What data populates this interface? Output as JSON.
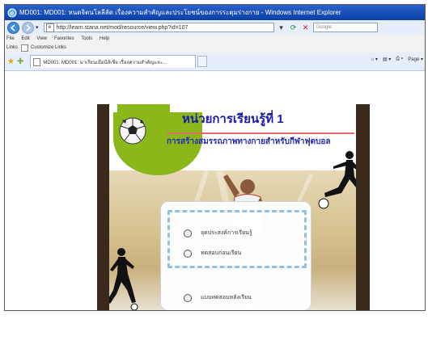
{
  "browser": {
    "window_title": "MD001: MD001: หนดจิตนโลลีลัด เรื่องความสำคัญและประโยชน์ของการระดุมร่างกาย - Windows Internet Explorer",
    "address_url": "http://learn.stana.net/mod/resource/view.php?id=107",
    "search_placeholder": "Google",
    "menu": [
      "File",
      "Edit",
      "View",
      "Favorites",
      "Tools",
      "Help"
    ],
    "links_label": "Links",
    "links_item": "Customize Links",
    "tab_title": "MD001: MD001: มาเรียนเมือนีส์เชีย เรื่องความสำคัญและ...",
    "page_label": "Page ▾"
  },
  "lesson": {
    "heading": "หน่วยการเรียนรู้ที่ 1",
    "subheading": "การสร้างสมรรถภาพทางกายสำหรับกีฬาฟุตบอล",
    "menu_items": [
      {
        "label": "จุดประสงค์การเรียนรู้"
      },
      {
        "label": "ทดสอบก่อนเรียน"
      },
      {
        "label": "แบบทดสอบหลังเรียน"
      }
    ]
  },
  "colors": {
    "heading": "#1a1aa6",
    "green": "#8ab81a",
    "dash": "#8fc2e0",
    "frame_bars": "#3a2a1c"
  }
}
